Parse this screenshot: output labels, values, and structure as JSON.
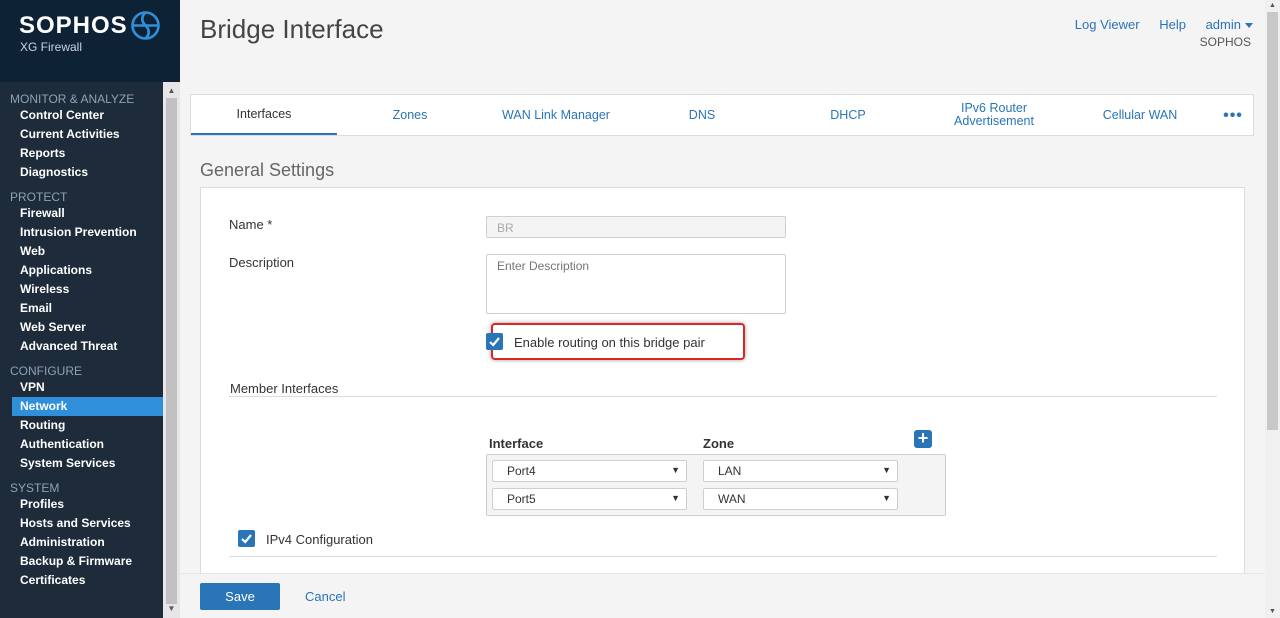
{
  "brand": {
    "name": "SOPHOS",
    "product": "XG Firewall"
  },
  "menu": {
    "monitor": {
      "title": "MONITOR & ANALYZE",
      "items": [
        "Control Center",
        "Current Activities",
        "Reports",
        "Diagnostics"
      ]
    },
    "protect": {
      "title": "PROTECT",
      "items": [
        "Firewall",
        "Intrusion Prevention",
        "Web",
        "Applications",
        "Wireless",
        "Email",
        "Web Server",
        "Advanced Threat"
      ]
    },
    "configure": {
      "title": "CONFIGURE",
      "items": [
        "VPN",
        "Network",
        "Routing",
        "Authentication",
        "System Services"
      ],
      "active": "Network"
    },
    "system": {
      "title": "SYSTEM",
      "items": [
        "Profiles",
        "Hosts and Services",
        "Administration",
        "Backup & Firmware",
        "Certificates"
      ]
    }
  },
  "header": {
    "title": "Bridge Interface",
    "links": [
      "Log Viewer",
      "Help",
      "admin"
    ],
    "org": "SOPHOS"
  },
  "tabs": [
    "Interfaces",
    "Zones",
    "WAN Link Manager",
    "DNS",
    "DHCP",
    "IPv6 Router Advertisement",
    "Cellular WAN"
  ],
  "active_tab": "Interfaces",
  "tabs_more": "•••",
  "general": {
    "heading": "General Settings",
    "name_label": "Name *",
    "name_value": "BR",
    "description_label": "Description",
    "description_placeholder": "Enter Description",
    "enable_routing_label": "Enable routing on this bridge pair",
    "enable_routing_checked": true
  },
  "members": {
    "heading": "Member Interfaces",
    "col_interface": "Interface",
    "col_zone": "Zone",
    "rows": [
      {
        "interface": "Port4",
        "zone": "LAN"
      },
      {
        "interface": "Port5",
        "zone": "WAN"
      }
    ],
    "add": "+"
  },
  "ipv4": {
    "label": "IPv4 Configuration",
    "checked": true
  },
  "footer": {
    "save": "Save",
    "cancel": "Cancel"
  },
  "colors": {
    "accent": "#2a74b8",
    "sidebar": "#1d2b3a",
    "highlight": "#d62828"
  }
}
